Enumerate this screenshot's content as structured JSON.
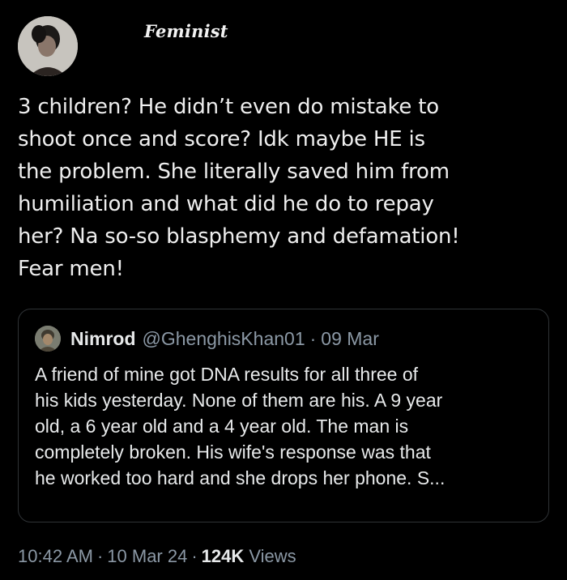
{
  "author": {
    "name": "Feminist"
  },
  "tweet": {
    "lines": [
      "3 children? He didn’t even do mistake to",
      "shoot once and score? Idk maybe HE is",
      "the problem. She literally saved him from",
      "humiliation and what did he do to repay",
      "her? Na so-so blasphemy and defamation!",
      "Fear men!"
    ]
  },
  "quoted_tweet": {
    "name": "Nimrod",
    "handle": "@GhenghisKhan01",
    "separator": "·",
    "date": "09 Mar",
    "lines": [
      "A friend of mine got DNA results for all three of",
      "his kids yesterday. None of them are his. A 9 year",
      "old, a 6 year old and a 4 year old. The man is",
      "completely broken. His wife's response was that",
      "he worked too hard and she drops her phone. S..."
    ]
  },
  "meta": {
    "time": "10:42 AM",
    "separator": "·",
    "date": "10 Mar 24",
    "views_count": "124K",
    "views_label": "Views"
  }
}
